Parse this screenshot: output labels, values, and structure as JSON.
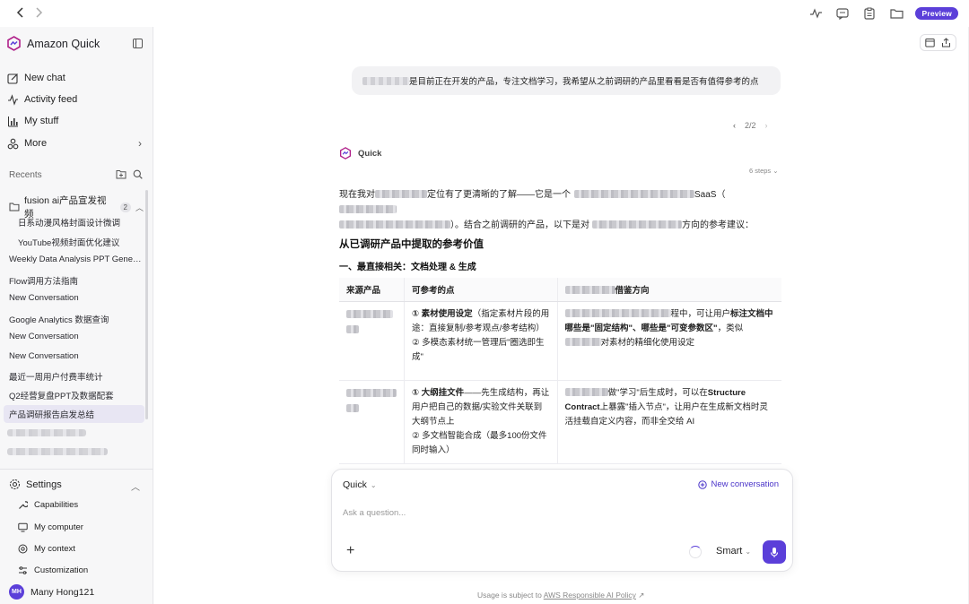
{
  "topbar": {
    "back_icon": "chevron-left-icon",
    "forward_icon": "chevron-right-icon",
    "preview_badge": "Preview"
  },
  "sidebar": {
    "brand": "Amazon Quick",
    "nav": [
      {
        "label": "New chat",
        "icon": "edit-icon"
      },
      {
        "label": "Activity feed",
        "icon": "pulse-icon"
      },
      {
        "label": "My stuff",
        "icon": "bar-chart-icon"
      },
      {
        "label": "More",
        "icon": "shapes-icon"
      }
    ],
    "recents_label": "Recents",
    "folder": {
      "name": "fusion ai产品宣发视频",
      "count": "2"
    },
    "folder_items": [
      "日系动漫风格封面设计微调",
      "YouTube视频封面优化建议"
    ],
    "recents": [
      "Weekly Data Analysis PPT Generation",
      "Flow调用方法指南",
      "New Conversation",
      "Google Analytics 数据查询",
      "New Conversation",
      "New Conversation",
      "最近一周用户付费率统计",
      "Q2经营复盘PPT及数据配套"
    ],
    "active_recent": "产品调研报告启发总结",
    "settings": {
      "label": "Settings",
      "items": [
        "Capabilities",
        "My computer",
        "My context",
        "Customization"
      ]
    },
    "user": {
      "initials": "MH",
      "name": "Many Hong121"
    }
  },
  "chat": {
    "user_message": "是目前正在开发的产品，专注文档学习，我希望从之前调研的产品里看看是否有值得参考的点",
    "pager": "2/2",
    "assistant_name": "Quick",
    "steps": "6 steps",
    "intro_a": "现在我对",
    "intro_b": "定位有了更清晰的了解——它是一个",
    "intro_c": "SaaS（",
    "intro_d": "）。结合之前调研的产品，以下是对",
    "intro_e": "方向的参考建议：",
    "heading": "从已调研产品中提取的参考价值",
    "subheading": "一、最直接相关：文档处理 & 生成",
    "table": {
      "headers": [
        "来源产品",
        "可参考的点",
        "借鉴方向"
      ],
      "row1": {
        "p1_bold": "① 素材使用设定",
        "p1_rest": "（指定素材片段的用途：直接复制/参考观点/参考结构）",
        "p2": "② 多模态素材统一管理后\"圈选即生成\"",
        "d_a": "程中，可让用户",
        "d_bold1": "标注文档中哪些是\"固定结构\"、哪些是\"可变参数区\"",
        "d_b": "，类似",
        "d_c": "对素材的精细化使用设定"
      },
      "row2": {
        "p1_bold": "① 大纲挂文件",
        "p1_rest": "——先生成结构，再让用户把自己的数据/实验文件关联到大纲节点上",
        "p2": "② 多文档智能合成（最多100份文件同时输入）",
        "d_a": "做\"学习\"后生成时，可以在",
        "d_bold1": "Structure Contract",
        "d_b": "上暴露\"插入节点\"，让用户在生成新文档时灵活挂载自定义内容，而非全交给 AI"
      }
    }
  },
  "composer": {
    "mode": "Quick",
    "new_conversation": "New conversation",
    "placeholder": "Ask a question...",
    "model": "Smart"
  },
  "footer": {
    "prefix": "Usage is subject to",
    "link": "AWS Responsible AI Policy"
  },
  "colors": {
    "accent": "#5b3fd9",
    "sidebar_bg": "#f7f7f8",
    "active_item": "#e8e6f3"
  }
}
